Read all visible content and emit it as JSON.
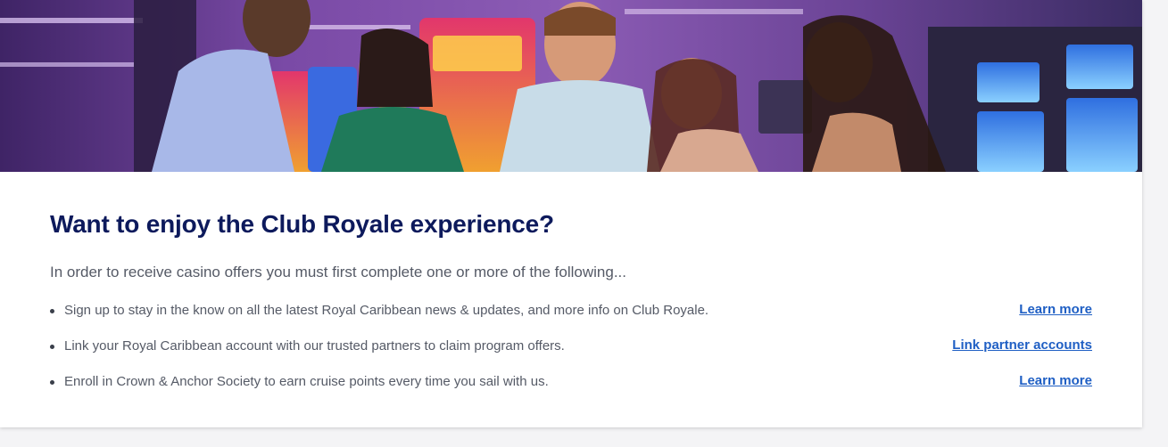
{
  "hero": {
    "image_alt": "casino-guests-photo"
  },
  "main": {
    "heading": "Want to enjoy the Club Royale experience?",
    "intro": "In order to receive casino offers you must first complete one or more of the following...",
    "items": [
      {
        "text": "Sign up to stay in the know on all the latest Royal Caribbean news & updates, and more info on Club Royale.",
        "link": "Learn more"
      },
      {
        "text": "Link your Royal Caribbean account with our trusted partners to claim program offers.",
        "link": "Link partner accounts"
      },
      {
        "text": "Enroll in Crown & Anchor Society to earn cruise points every time you sail with us.",
        "link": "Learn more"
      }
    ]
  },
  "colors": {
    "heading": "#0d1a5c",
    "body_text": "#555a66",
    "link": "#1f5fc4",
    "page_bg": "#f4f4f6"
  }
}
